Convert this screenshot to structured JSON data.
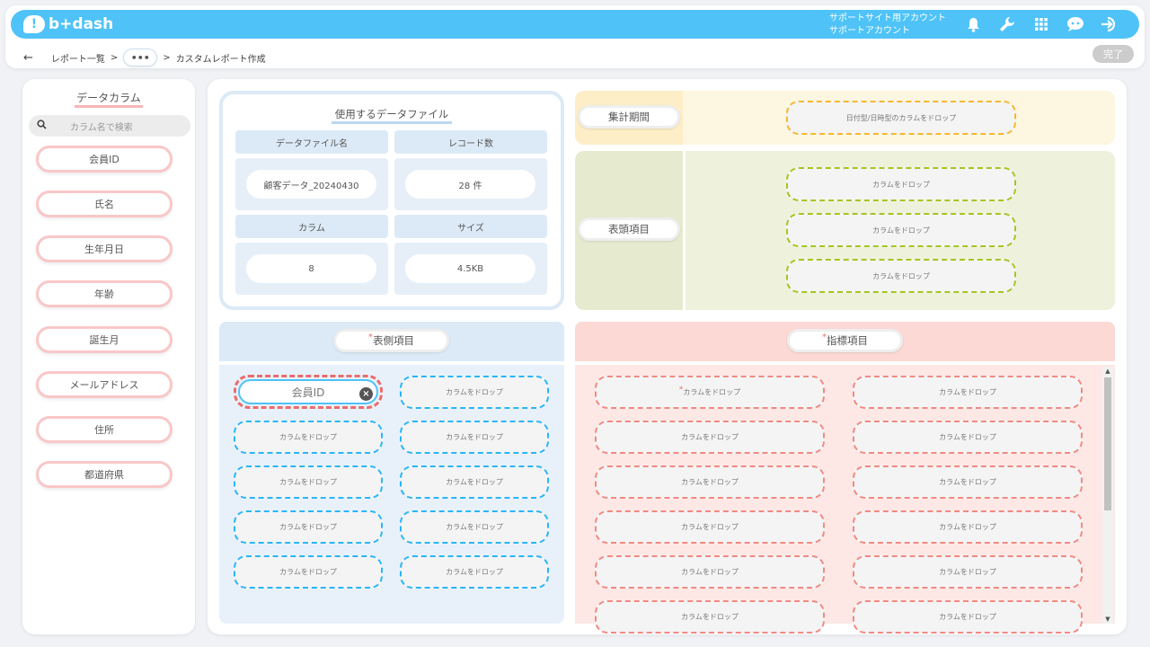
{
  "header": {
    "logo_text": "b+dash",
    "account_line1": "サポートサイト用アカウント",
    "account_line2": "サポートアカウント",
    "icons": [
      "bell-icon",
      "wrench-icon",
      "grid-icon",
      "chat-bot-icon",
      "logout-icon"
    ]
  },
  "breadcrumb": {
    "back": "←",
    "report_list": "レポート一覧",
    "sep1": ">",
    "ellipsis": "•••",
    "sep2": ">",
    "current": "カスタムレポート作成",
    "done_label": "完了"
  },
  "sidebar": {
    "title": "データカラム",
    "search_placeholder": "カラム名で検索",
    "columns": [
      "会員ID",
      "氏名",
      "生年月日",
      "年齢",
      "誕生月",
      "メールアドレス",
      "住所",
      "都道府県"
    ]
  },
  "file_info": {
    "title": "使用するデータファイル",
    "file_name_header": "データファイル名",
    "file_name": "顧客データ_20240430",
    "record_header": "レコード数",
    "record_value": "28 件",
    "column_header": "カラム",
    "column_value": "8",
    "size_header": "サイズ",
    "size_value": "4.5KB"
  },
  "period": {
    "label": "集計期間",
    "drop_text": "日付型/日時型のカラムをドロップ"
  },
  "header_items": {
    "label": "表頭項目",
    "drops": [
      "カラムをドロップ",
      "カラムをドロップ",
      "カラムをドロップ"
    ]
  },
  "side_items": {
    "label": "表側項目",
    "required_mark": "*",
    "filled_value": "会員ID",
    "remove_icon": "×",
    "drop_text": "カラムをドロップ"
  },
  "metrics": {
    "label": "指標項目",
    "required_mark": "*",
    "drop_text": "カラムをドロップ"
  },
  "colors": {
    "brand": "#4fc3f7",
    "side_zone": "#e8f1fa",
    "metrics_zone": "#fde8e6",
    "period_zone": "#fdf4dc",
    "header_zone": "#eef2dc"
  }
}
